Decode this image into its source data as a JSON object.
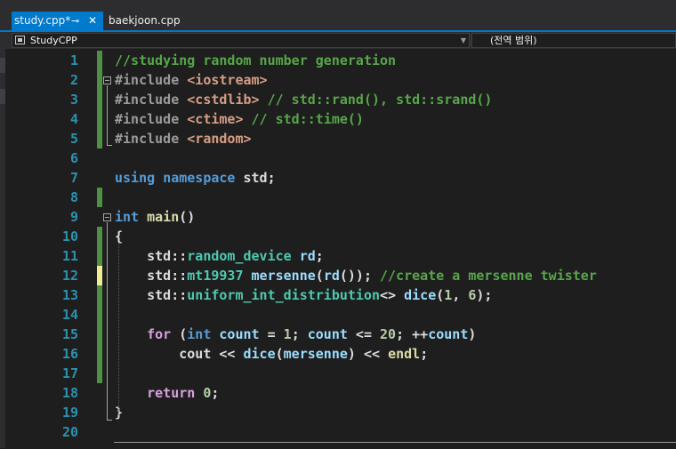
{
  "tabs": {
    "active_label": "study.cpp*",
    "pin_glyph": "⊸",
    "close_glyph": "✕",
    "inactive_label": "baekjoon.cpp"
  },
  "nav": {
    "project": "StudyCPP",
    "scope": "(전역 범위)"
  },
  "editor": {
    "lines": [
      {
        "n": "1",
        "change": "green",
        "tokens": [
          [
            "cm",
            "//studying random number generation"
          ]
        ]
      },
      {
        "n": "2",
        "change": "green",
        "fold": "open",
        "tokens": [
          [
            "pp",
            "#include "
          ],
          [
            "str",
            "<iostream>"
          ]
        ]
      },
      {
        "n": "3",
        "change": "green",
        "tokens": [
          [
            "pp",
            "#include "
          ],
          [
            "str",
            "<cstdlib>"
          ],
          [
            "",
            " "
          ],
          [
            "cm",
            "// std::rand(), std::srand()"
          ]
        ]
      },
      {
        "n": "4",
        "change": "green",
        "tokens": [
          [
            "pp",
            "#include "
          ],
          [
            "str",
            "<ctime>"
          ],
          [
            "",
            " "
          ],
          [
            "cm",
            "// std::time()"
          ]
        ]
      },
      {
        "n": "5",
        "change": "green",
        "tokens": [
          [
            "pp",
            "#include "
          ],
          [
            "str",
            "<random>"
          ]
        ]
      },
      {
        "n": "6",
        "change": "",
        "tokens": []
      },
      {
        "n": "7",
        "change": "",
        "tokens": [
          [
            "kw",
            "using"
          ],
          [
            "",
            " "
          ],
          [
            "kw",
            "namespace"
          ],
          [
            "",
            " std;"
          ]
        ]
      },
      {
        "n": "8",
        "change": "green",
        "tokens": []
      },
      {
        "n": "9",
        "change": "",
        "fold": "open",
        "tokens": [
          [
            "kw",
            "int"
          ],
          [
            "",
            " "
          ],
          [
            "fn",
            "main"
          ],
          [
            "",
            "()"
          ]
        ]
      },
      {
        "n": "10",
        "change": "green",
        "tokens": [
          [
            "",
            "{"
          ]
        ]
      },
      {
        "n": "11",
        "change": "green",
        "tokens": [
          [
            "",
            "    std::"
          ],
          [
            "ty",
            "random_device"
          ],
          [
            "",
            " "
          ],
          [
            "vr",
            "rd"
          ],
          [
            "",
            ";"
          ]
        ]
      },
      {
        "n": "12",
        "change": "yellow",
        "tokens": [
          [
            "",
            "    std::"
          ],
          [
            "ty",
            "mt19937"
          ],
          [
            "",
            " "
          ],
          [
            "vr",
            "mersenne"
          ],
          [
            "",
            "("
          ],
          [
            "vr",
            "rd"
          ],
          [
            "",
            "()); "
          ],
          [
            "cm",
            "//create a mersenne twister"
          ]
        ]
      },
      {
        "n": "13",
        "change": "green",
        "tokens": [
          [
            "",
            "    std::"
          ],
          [
            "ty",
            "uniform_int_distribution"
          ],
          [
            "",
            "<> "
          ],
          [
            "vr",
            "dice"
          ],
          [
            "",
            "("
          ],
          [
            "num",
            "1"
          ],
          [
            "",
            ", "
          ],
          [
            "num",
            "6"
          ],
          [
            "",
            ");"
          ]
        ]
      },
      {
        "n": "14",
        "change": "green",
        "tokens": []
      },
      {
        "n": "15",
        "change": "green",
        "tokens": [
          [
            "",
            "    "
          ],
          [
            "ctl",
            "for"
          ],
          [
            "",
            " ("
          ],
          [
            "kw",
            "int"
          ],
          [
            "",
            " "
          ],
          [
            "vr",
            "count"
          ],
          [
            "",
            " = "
          ],
          [
            "num",
            "1"
          ],
          [
            "",
            "; "
          ],
          [
            "vr",
            "count"
          ],
          [
            "",
            " <= "
          ],
          [
            "num",
            "20"
          ],
          [
            "",
            "; ++"
          ],
          [
            "vr",
            "count"
          ],
          [
            "",
            ")"
          ]
        ]
      },
      {
        "n": "16",
        "change": "green",
        "tokens": [
          [
            "",
            "        cout << "
          ],
          [
            "vr",
            "dice"
          ],
          [
            "",
            "("
          ],
          [
            "vr",
            "mersenne"
          ],
          [
            "",
            ") << "
          ],
          [
            "fn",
            "endl"
          ],
          [
            "",
            ";"
          ]
        ]
      },
      {
        "n": "17",
        "change": "green",
        "tokens": []
      },
      {
        "n": "18",
        "change": "",
        "tokens": [
          [
            "",
            "    "
          ],
          [
            "ctl",
            "return"
          ],
          [
            "",
            " "
          ],
          [
            "num",
            "0"
          ],
          [
            "",
            ";"
          ]
        ]
      },
      {
        "n": "19",
        "change": "",
        "tokens": [
          [
            "",
            "}"
          ]
        ]
      },
      {
        "n": "20",
        "change": "",
        "tokens": []
      }
    ]
  }
}
